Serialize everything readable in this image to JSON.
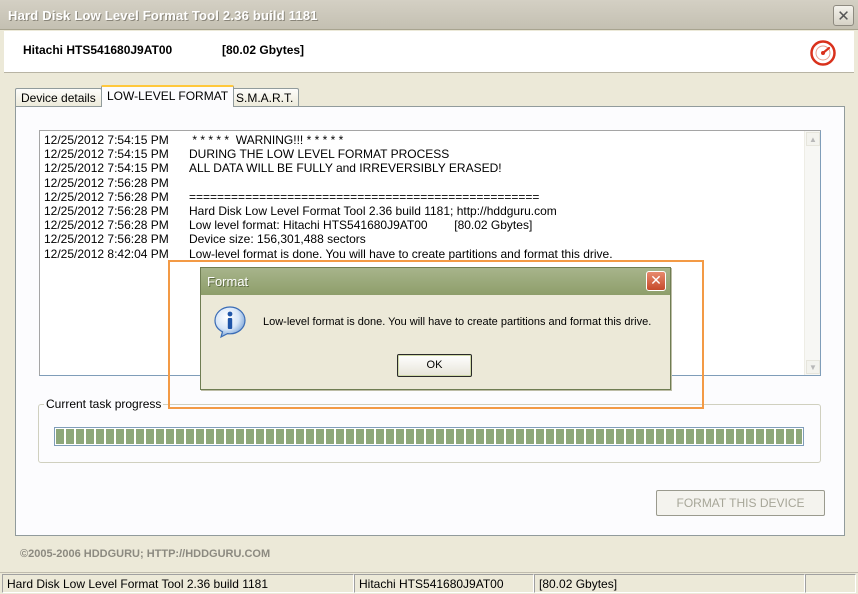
{
  "window": {
    "title": "Hard Disk Low Level Format Tool 2.36 build 1181",
    "close_glyph": "✕"
  },
  "header": {
    "model": "Hitachi HTS541680J9AT00",
    "size": "[80.02 Gbytes]"
  },
  "tabs": [
    {
      "label": "Device details",
      "active": false
    },
    {
      "label": "LOW-LEVEL FORMAT",
      "active": true
    },
    {
      "label": "S.M.A.R.T.",
      "active": false
    }
  ],
  "log": [
    {
      "time": "12/25/2012 7:54:15 PM",
      "text": " * * * * *  WARNING!!! * * * * *"
    },
    {
      "time": "12/25/2012 7:54:15 PM",
      "text": "DURING THE LOW LEVEL FORMAT PROCESS"
    },
    {
      "time": "12/25/2012 7:54:15 PM",
      "text": "ALL DATA WILL BE FULLY and IRREVERSIBLY ERASED!"
    },
    {
      "time": "12/25/2012 7:56:28 PM",
      "text": ""
    },
    {
      "time": "12/25/2012 7:56:28 PM",
      "text": "=================================================="
    },
    {
      "time": "12/25/2012 7:56:28 PM",
      "text": "Hard Disk Low Level Format Tool 2.36 build 1181; http://hddguru.com"
    },
    {
      "time": "12/25/2012 7:56:28 PM",
      "text": "Low level format: Hitachi HTS541680J9AT00        [80.02 Gbytes]"
    },
    {
      "time": "12/25/2012 7:56:28 PM",
      "text": "Device size: 156,301,488 sectors"
    },
    {
      "time": "12/25/2012 8:42:04 PM",
      "text": "Low-level format is done. You will have to create partitions and format this drive."
    }
  ],
  "progress": {
    "label": "Current task progress",
    "value": 1.0
  },
  "format_button": "FORMAT THIS DEVICE",
  "copyright": "©2005-2006 HDDGURU;   HTTP://HDDGURU.COM",
  "statusbar": {
    "app": "Hard Disk Low Level Format Tool 2.36 build 1181",
    "model": "Hitachi HTS541680J9AT00",
    "size": "[80.02 Gbytes]"
  },
  "dialog": {
    "title": "Format",
    "close_glyph": "✕",
    "message": "Low-level format is done. You will have to create partitions and format this drive.",
    "ok_label": "OK"
  },
  "colors": {
    "highlight": "#f39a45",
    "dialog_title": "#8e9e6a",
    "progress_fill": "#8da77a"
  },
  "icons": [
    "close-icon",
    "hddguru-logo-icon",
    "info-icon"
  ]
}
